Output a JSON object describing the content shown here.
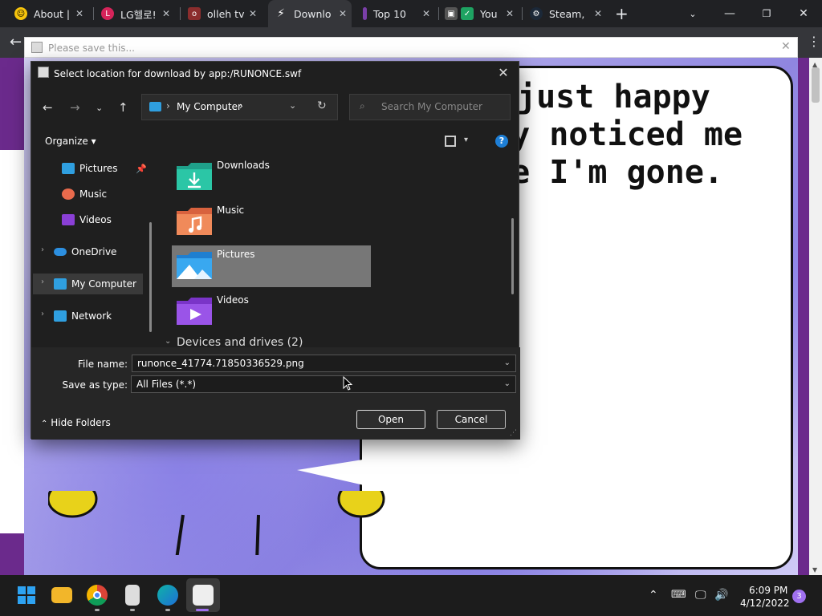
{
  "browser": {
    "tabs": [
      {
        "label": "About |",
        "favicon_color": "#f6c40c"
      },
      {
        "label": "LG헬로!",
        "favicon_color": "#d6245a"
      },
      {
        "label": "olleh tv",
        "favicon_color": "#8b2d2d"
      },
      {
        "label": "Downlo",
        "favicon_color": "#ffffff"
      },
      {
        "label": "Top 10",
        "favicon_color": "#7a3fa8"
      },
      {
        "label": "You",
        "favicon_color": "#1ea362"
      },
      {
        "label": "Steam,",
        "favicon_color": "#1b2838"
      }
    ],
    "new_tab_icon": "plus-icon"
  },
  "flash_window": {
    "title": "Please save this...",
    "speech_text": [
      "just happy",
      "dy noticed me",
      "re I'm gone."
    ]
  },
  "dialog": {
    "title": "Select location for download by app:/RUNONCE.swf",
    "address": {
      "location": "My Computer"
    },
    "search_placeholder": "Search My Computer",
    "organize_label": "Organize",
    "nav_items": [
      {
        "label": "Pictures",
        "icon": "pictures-icon",
        "pinned": true
      },
      {
        "label": "Music",
        "icon": "music-icon"
      },
      {
        "label": "Videos",
        "icon": "videos-icon"
      },
      {
        "label": "OneDrive",
        "icon": "cloud-icon"
      },
      {
        "label": "My Computer",
        "icon": "computer-icon",
        "selected": true
      },
      {
        "label": "Network",
        "icon": "network-icon"
      }
    ],
    "folders": [
      {
        "label": "Downloads",
        "icon": "downloads-folder-icon"
      },
      {
        "label": "Music",
        "icon": "music-folder-icon"
      },
      {
        "label": "Pictures",
        "icon": "pictures-folder-icon",
        "selected": true
      },
      {
        "label": "Videos",
        "icon": "videos-folder-icon"
      }
    ],
    "section_header": "Devices and drives (2)",
    "file_name_label": "File name:",
    "file_name_value": "runonce_41774.71850336529.png",
    "save_as_type_label": "Save as type:",
    "save_as_type_value": "All Files (*.*)",
    "hide_folders_label": "Hide Folders",
    "open_label": "Open",
    "cancel_label": "Cancel"
  },
  "taskbar": {
    "time": "6:09 PM",
    "date": "4/12/2022",
    "notification_count": "3"
  }
}
